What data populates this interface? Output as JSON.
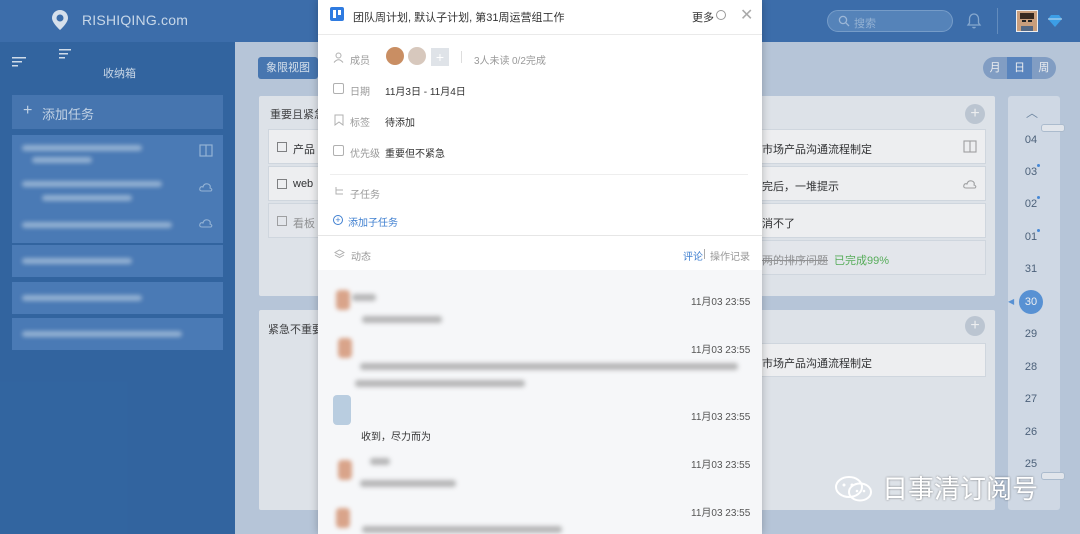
{
  "app": {
    "logo_text": "RISHIQING.com",
    "search_placeholder": "搜索"
  },
  "sidebar": {
    "inbox_label": "收纳箱",
    "add_task_label": "添加任务"
  },
  "main": {
    "view_button": "象限视图",
    "segment": [
      "月",
      "日",
      "周"
    ],
    "segment_active": "日",
    "quadrant_important_urgent": {
      "title_visible": "重要且紧急",
      "tasks": [
        "产品",
        "web",
        "看板"
      ]
    },
    "quadrant_urgent_not_important": {
      "title_visible": "紧急不重要"
    },
    "right_tasks_top": [
      "市场产品沟通流程制定",
      "完后，一堆提示",
      "消不了",
      "两的排序问题"
    ],
    "right_task_progress": "已完成99%",
    "right_tasks_bottom": [
      "市场产品沟通流程制定"
    ],
    "date_rail": [
      "04",
      "03",
      "02",
      "01",
      "31",
      "30",
      "29",
      "28",
      "27",
      "26",
      "25"
    ],
    "date_selected": "30"
  },
  "panel": {
    "title": "团队周计划, 默认子计划, 第31周运营组工作",
    "more_label": "更多",
    "members_label": "成员",
    "members_status": "3人未读",
    "members_progress": "0/2完成",
    "date_label": "日期",
    "date_value": "11月3日 - 11月4日",
    "tag_label": "标签",
    "tag_value": "待添加",
    "priority_label": "优先级",
    "priority_value": "重要但不紧急",
    "subtask_label": "子任务",
    "add_subtask": "添加子任务",
    "activity_label": "动态",
    "comment_tab": "评论",
    "log_tab": "操作记录",
    "activities": [
      {
        "time": "11月03 23:55"
      },
      {
        "time": "11月03 23:55"
      },
      {
        "time": "11月03 23:55",
        "text": "收到，尽力而为"
      },
      {
        "time": "11月03 23:55"
      },
      {
        "time": "11月03 23:55"
      }
    ]
  },
  "watermark": "日事清订阅号",
  "colors": {
    "topbar": "#3f74b4",
    "sidebar": "#356aa8",
    "accent": "#3f7fd0",
    "progress_green": "#5cb85c"
  }
}
